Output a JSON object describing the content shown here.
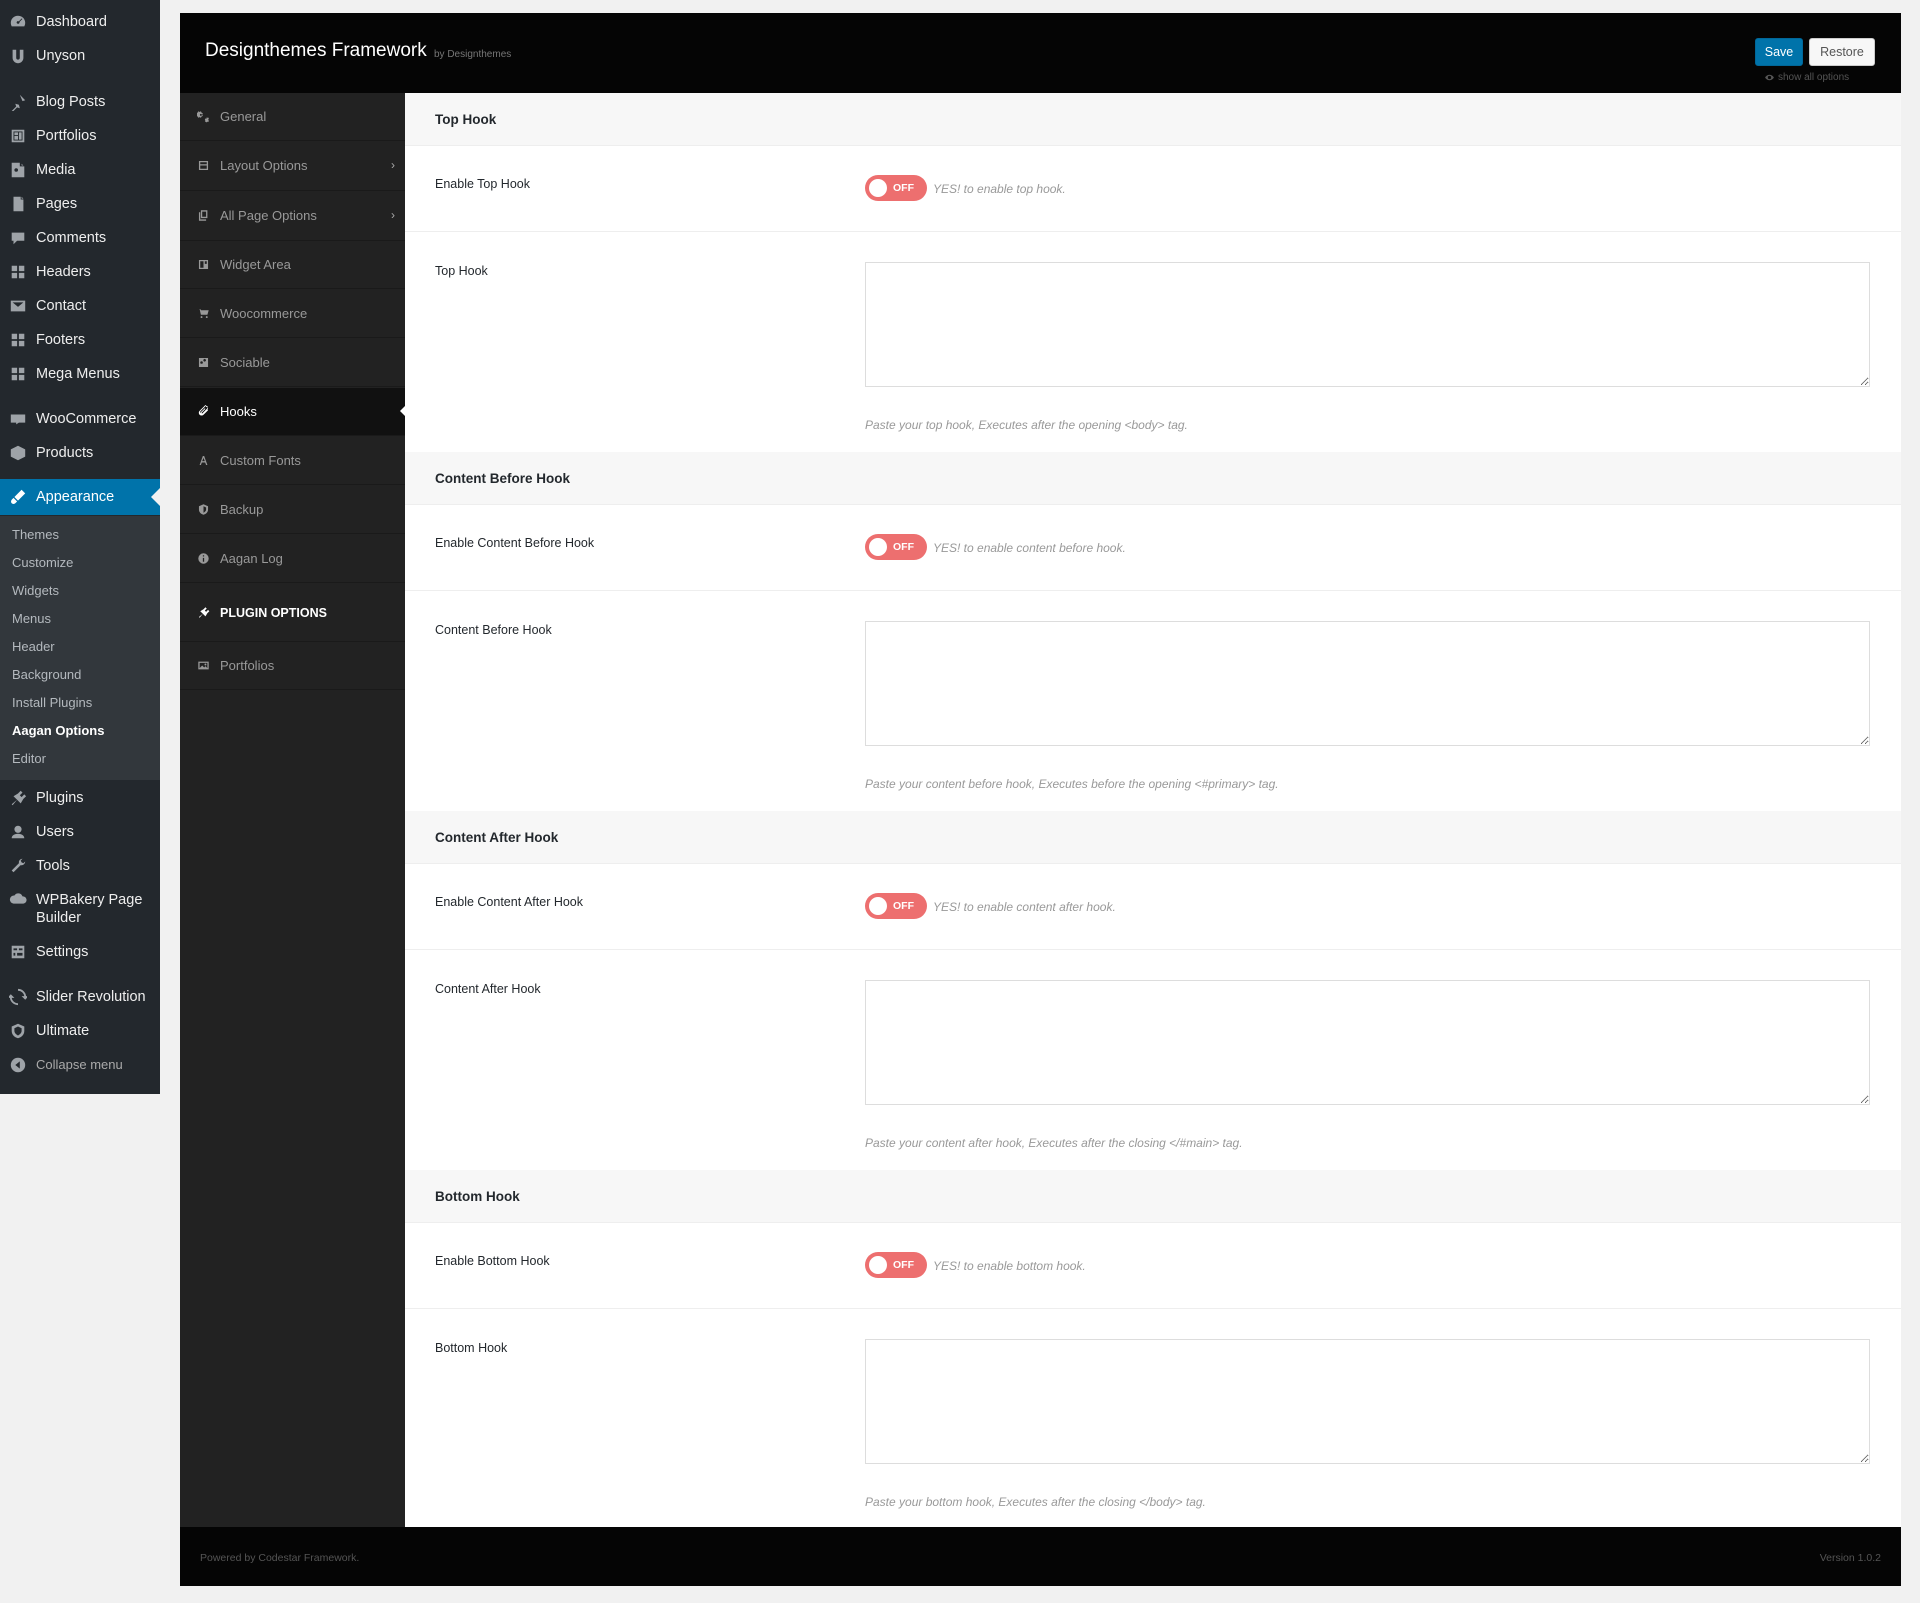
{
  "wp_menu": {
    "items": [
      {
        "label": "Dashboard",
        "icon": "dashboard-icon"
      },
      {
        "label": "Unyson",
        "icon": "unyson-icon"
      },
      {
        "label": "Blog Posts",
        "icon": "pin-icon"
      },
      {
        "label": "Portfolios",
        "icon": "portfolio-icon"
      },
      {
        "label": "Media",
        "icon": "media-icon"
      },
      {
        "label": "Pages",
        "icon": "pages-icon"
      },
      {
        "label": "Comments",
        "icon": "comments-icon"
      },
      {
        "label": "Headers",
        "icon": "grid-icon"
      },
      {
        "label": "Contact",
        "icon": "mail-icon"
      },
      {
        "label": "Footers",
        "icon": "grid-icon"
      },
      {
        "label": "Mega Menus",
        "icon": "grid-icon"
      },
      {
        "label": "WooCommerce",
        "icon": "woo-icon"
      },
      {
        "label": "Products",
        "icon": "products-icon"
      },
      {
        "label": "Appearance",
        "icon": "appearance-icon"
      },
      {
        "label": "Plugins",
        "icon": "plugins-icon"
      },
      {
        "label": "Users",
        "icon": "users-icon"
      },
      {
        "label": "Tools",
        "icon": "tools-icon"
      },
      {
        "label": "WPBakery Page",
        "label2": "Builder",
        "icon": "wpbakery-icon"
      },
      {
        "label": "Settings",
        "icon": "settings-icon"
      },
      {
        "label": "Slider Revolution",
        "icon": "slider-icon"
      },
      {
        "label": "Ultimate",
        "icon": "shield-icon"
      },
      {
        "label": "Collapse menu",
        "icon": "collapse-icon"
      }
    ],
    "appearance_sub": [
      "Themes",
      "Customize",
      "Widgets",
      "Menus",
      "Header",
      "Background",
      "Install Plugins",
      "Aagan Options",
      "Editor"
    ],
    "current_sub": "Aagan Options"
  },
  "header": {
    "title": "Designthemes Framework",
    "by": "by Designthemes",
    "save_label": "Save",
    "restore_label": "Restore",
    "show_all": "show all options"
  },
  "fw_nav": {
    "items": [
      {
        "label": "General",
        "icon": "gears-icon"
      },
      {
        "label": "Layout Options",
        "icon": "layout-icon"
      },
      {
        "label": "All Page Options",
        "icon": "pages-icon"
      },
      {
        "label": "Widget Area",
        "icon": "widget-icon"
      },
      {
        "label": "Woocommerce",
        "icon": "cart-icon"
      },
      {
        "label": "Sociable",
        "icon": "share-icon"
      },
      {
        "label": "Hooks",
        "icon": "paperclip-icon"
      },
      {
        "label": "Custom Fonts",
        "icon": "font-icon"
      },
      {
        "label": "Backup",
        "icon": "shield-icon"
      },
      {
        "label": "Aagan Log",
        "icon": "info-icon"
      },
      {
        "label": "PLUGIN OPTIONS",
        "icon": "plug-icon"
      },
      {
        "label": "Portfolios",
        "icon": "image-icon"
      }
    ],
    "active": "Hooks"
  },
  "sections": [
    {
      "title": "Top Hook",
      "toggle_label": "Enable Top Hook",
      "toggle_state": "OFF",
      "toggle_help": "YES! to enable top hook.",
      "area_label": "Top Hook",
      "area_value": "",
      "area_help": "Paste your top hook, Executes after the opening <body> tag."
    },
    {
      "title": "Content Before Hook",
      "toggle_label": "Enable Content Before Hook",
      "toggle_state": "OFF",
      "toggle_help": "YES! to enable content before hook.",
      "area_label": "Content Before Hook",
      "area_value": "",
      "area_help": "Paste your content before hook, Executes before the opening <#primary> tag."
    },
    {
      "title": "Content After Hook",
      "toggle_label": "Enable Content After Hook",
      "toggle_state": "OFF",
      "toggle_help": "YES! to enable content after hook.",
      "area_label": "Content After Hook",
      "area_value": "",
      "area_help": "Paste your content after hook, Executes after the closing </#main> tag."
    },
    {
      "title": "Bottom Hook",
      "toggle_label": "Enable Bottom Hook",
      "toggle_state": "OFF",
      "toggle_help": "YES! to enable bottom hook.",
      "area_label": "Bottom Hook",
      "area_value": "",
      "area_help": "Paste your bottom hook, Executes after the closing </body> tag."
    }
  ],
  "footer": {
    "left": "Powered by Codestar Framework.",
    "right": "Version 1.0.2"
  },
  "colors": {
    "wp_sidebar": "#23282d",
    "wp_active": "#0073aa",
    "toggle_off": "#ed6f6f",
    "panel_header": "#050505",
    "fw_nav": "#222222"
  }
}
